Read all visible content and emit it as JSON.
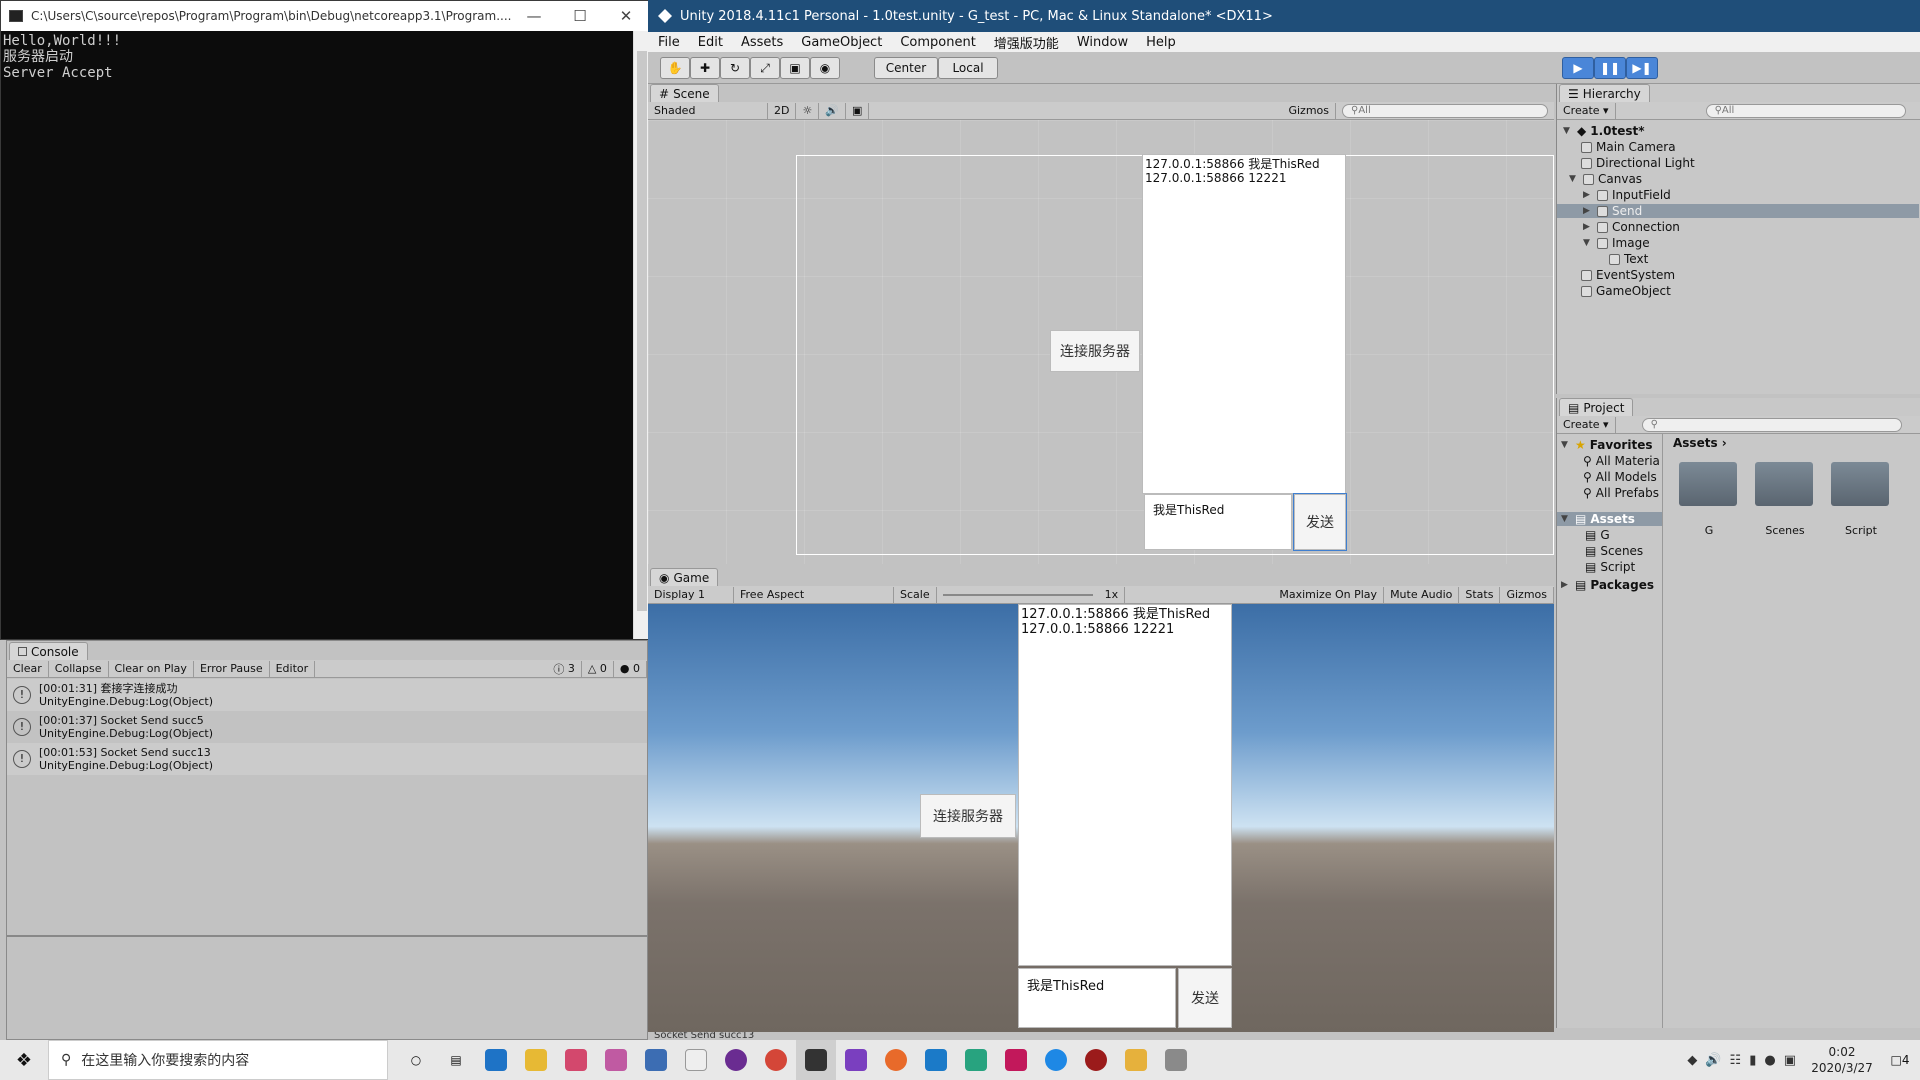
{
  "cmd": {
    "title": "C:\\Users\\C\\source\\repos\\Program\\Program\\bin\\Debug\\netcoreapp3.1\\Program....",
    "output": "Hello,World!!!\n服务器启动\nServer Accept"
  },
  "unity": {
    "title": "Unity 2018.4.11c1 Personal - 1.0test.unity - G_test - PC, Mac & Linux Standalone* <DX11>",
    "menu": [
      "File",
      "Edit",
      "Assets",
      "GameObject",
      "Component",
      "增强版功能",
      "Window",
      "Help"
    ],
    "toolbar": {
      "center": "Center",
      "local": "Local"
    },
    "scene": {
      "tab": "Scene",
      "shaded": "Shaded",
      "mode2d": "2D",
      "gizmos": "Gizmos",
      "search_placeholder": "All",
      "log_line1": "127.0.0.1:58866 我是ThisRed",
      "log_line2": "127.0.0.1:58866 12221",
      "connect_button": "连接服务器",
      "input_text": "我是ThisRed",
      "send_button": "发送"
    },
    "game": {
      "tab": "Game",
      "display": "Display 1",
      "aspect": "Free Aspect",
      "scale_label": "Scale",
      "scale_value": "1x",
      "maximize": "Maximize On Play",
      "mute": "Mute Audio",
      "stats": "Stats",
      "gizmos": "Gizmos",
      "log_line1": "127.0.0.1:58866 我是ThisRed",
      "log_line2": "127.0.0.1:58866 12221",
      "connect_button": "连接服务器",
      "input_text": "我是ThisRed",
      "send_button": "发送"
    },
    "status_bar": "Socket Send succ13"
  },
  "console": {
    "tab": "Console",
    "buttons": [
      "Clear",
      "Collapse",
      "Clear on Play",
      "Error Pause",
      "Editor"
    ],
    "counts": {
      "info": "3",
      "warn": "0",
      "error": "0"
    },
    "entries": [
      {
        "line1": "[00:01:31] 套接字连接成功",
        "line2": "UnityEngine.Debug:Log(Object)"
      },
      {
        "line1": "[00:01:37] Socket Send succ5",
        "line2": "UnityEngine.Debug:Log(Object)"
      },
      {
        "line1": "[00:01:53] Socket Send succ13",
        "line2": "UnityEngine.Debug:Log(Object)"
      }
    ]
  },
  "hierarchy": {
    "tab": "Hierarchy",
    "create": "Create",
    "search_placeholder": "All",
    "scene_name": "1.0test*",
    "items": [
      "Main Camera",
      "Directional Light",
      "Canvas",
      "InputField",
      "Send",
      "Connection",
      "Image",
      "Text",
      "EventSystem",
      "GameObject"
    ]
  },
  "project": {
    "tab": "Project",
    "create": "Create",
    "favorites": "Favorites",
    "fav_items": [
      "All Materia",
      "All Models",
      "All Prefabs"
    ],
    "assets_header": "Assets",
    "tree_assets": "Assets",
    "tree_items": [
      "G",
      "Scenes",
      "Script"
    ],
    "packages": "Packages",
    "folders": [
      "G",
      "Scenes",
      "Script"
    ]
  },
  "taskbar": {
    "search_placeholder": "在这里输入你要搜索的内容",
    "time": "0:02",
    "date": "2020/3/27",
    "notification_count": "4"
  }
}
